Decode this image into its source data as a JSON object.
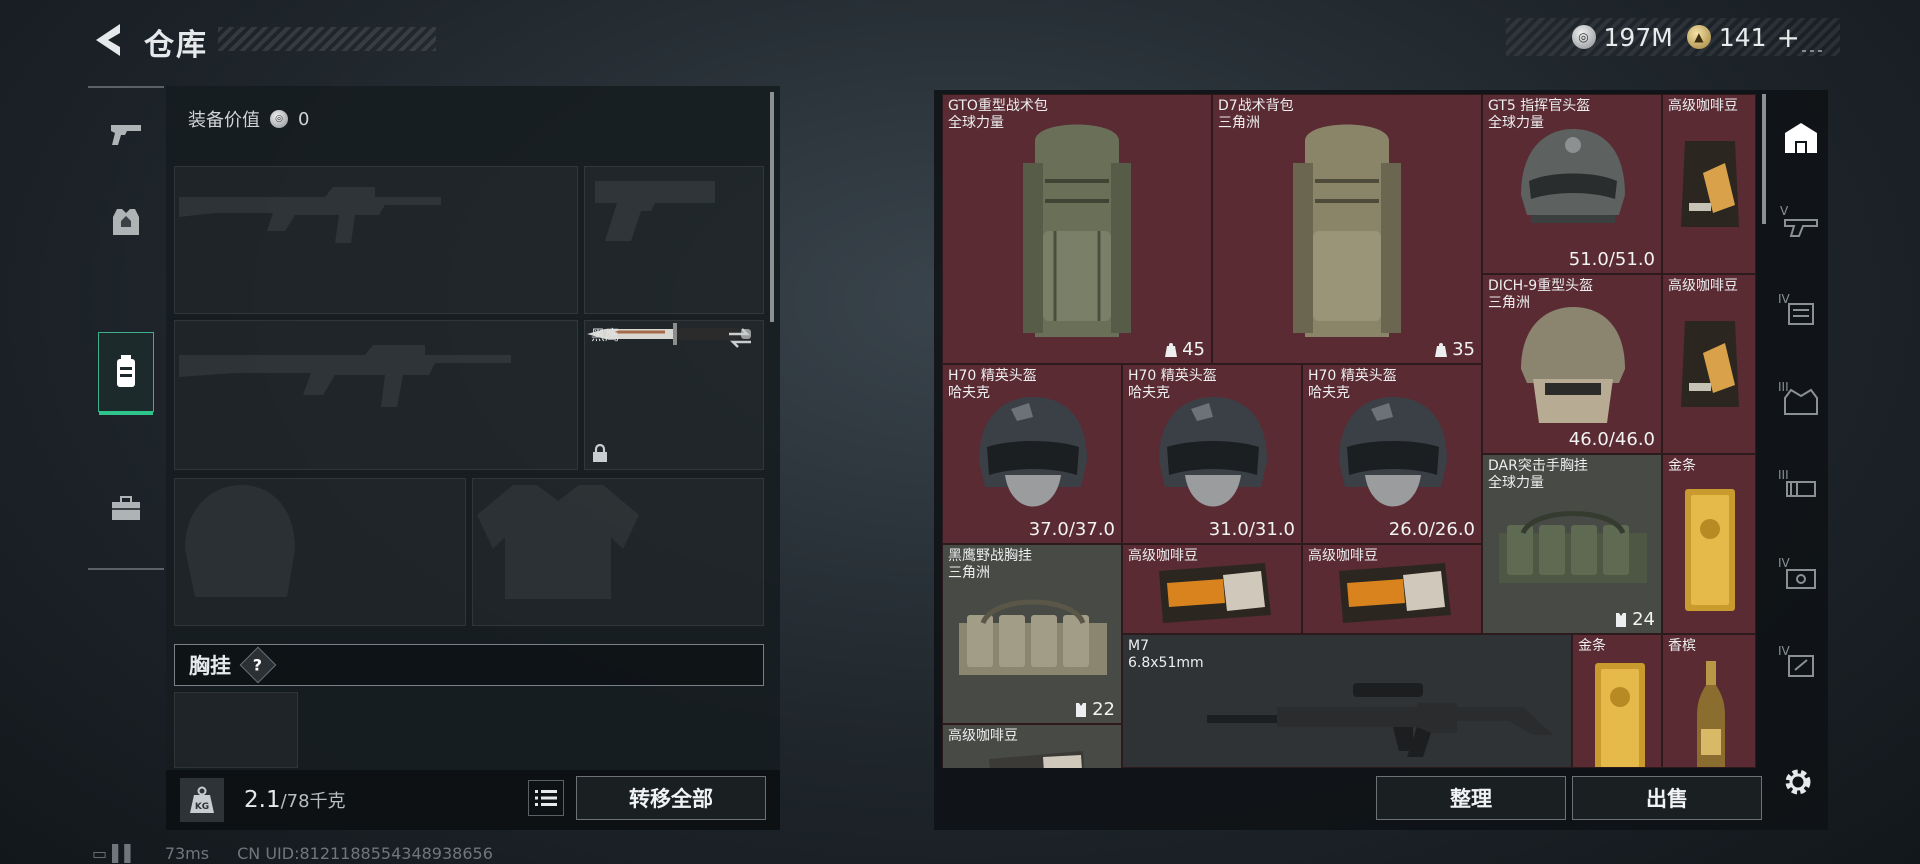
{
  "header": {
    "title": "仓库",
    "currency_silver": "197M",
    "currency_gold": "141",
    "plus": "+"
  },
  "equipment": {
    "value_label": "装备价值",
    "value": "0",
    "knife_label": "黑鹰",
    "chest_label": "胸挂",
    "help": "?"
  },
  "footer": {
    "kg_icon_text": "KG",
    "weight_current": "2.1",
    "weight_max": "/78千克",
    "transfer_all": "转移全部",
    "sort": "整理",
    "sell": "出售"
  },
  "status": {
    "ping": "73ms",
    "uid": "CN UID:8121188554348938656"
  },
  "inventory": [
    {
      "name": "GTO重型战术包",
      "sub": "全球力量",
      "stat": "45",
      "stat_icon": "capacity-icon"
    },
    {
      "name": "D7战术背包",
      "sub": "三角洲",
      "stat": "35",
      "stat_icon": "capacity-icon"
    },
    {
      "name": "GT5 指挥官头盔",
      "sub": "全球力量",
      "stat": "51.0/51.0"
    },
    {
      "name": "高级咖啡豆",
      "sub": ""
    },
    {
      "name": "DICH-9重型头盔",
      "sub": "三角洲",
      "stat": "46.0/46.0"
    },
    {
      "name": "高级咖啡豆",
      "sub": ""
    },
    {
      "name": "H70 精英头盔",
      "sub": "哈夫克",
      "stat": "37.0/37.0"
    },
    {
      "name": "H70 精英头盔",
      "sub": "哈夫克",
      "stat": "31.0/31.0"
    },
    {
      "name": "H70 精英头盔",
      "sub": "哈夫克",
      "stat": "26.0/26.0"
    },
    {
      "name": "DAR突击手胸挂",
      "sub": "全球力量",
      "stat": "24",
      "stat_icon": "vest-capacity-icon"
    },
    {
      "name": "金条",
      "sub": ""
    },
    {
      "name": "黑鹰野战胸挂",
      "sub": "三角洲",
      "stat": "22",
      "stat_icon": "vest-capacity-icon"
    },
    {
      "name": "高级咖啡豆",
      "sub": ""
    },
    {
      "name": "高级咖啡豆",
      "sub": ""
    },
    {
      "name": "M7",
      "sub": "6.8x51mm"
    },
    {
      "name": "金条",
      "sub": ""
    },
    {
      "name": "香槟",
      "sub": ""
    },
    {
      "name": "高级咖啡豆",
      "sub": ""
    }
  ],
  "filter_tabs": [
    "V",
    "IV",
    "III",
    "III",
    "IV",
    "IV"
  ],
  "colors": {
    "accent_green": "#2fc48c",
    "rare_red": "#5a2b33",
    "uncommon_gray": "#474a45"
  }
}
